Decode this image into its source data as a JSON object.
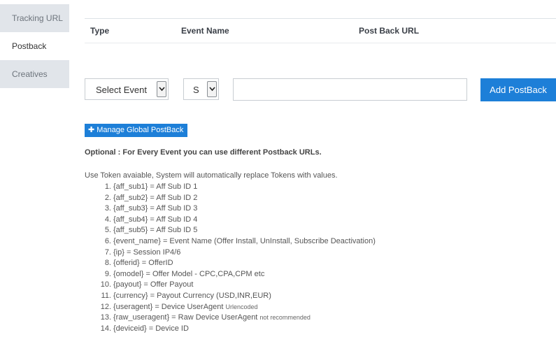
{
  "sidebar": {
    "items": [
      {
        "label": "Tracking URL"
      },
      {
        "label": "Postback"
      },
      {
        "label": "Creatives"
      }
    ]
  },
  "table": {
    "headers": [
      "Type",
      "Event Name",
      "Post Back URL"
    ]
  },
  "form": {
    "event_select": {
      "value": "Select Event"
    },
    "type_select": {
      "value": "S"
    },
    "url_input": {
      "value": "",
      "placeholder": ""
    },
    "add_label": "Add PostBack"
  },
  "global_button": {
    "label": "Manage Global PostBack"
  },
  "optional_text": "Optional : For Every Event you can use different Postback URLs.",
  "intro_text": "Use Token avaiable, System will automatically replace Tokens with values.",
  "tokens": [
    {
      "num": "1.",
      "text": "{aff_sub1} = Aff Sub ID 1",
      "note": ""
    },
    {
      "num": "2.",
      "text": "{aff_sub2} = Aff Sub ID 2",
      "note": ""
    },
    {
      "num": "3.",
      "text": "{aff_sub3} = Aff Sub ID 3",
      "note": ""
    },
    {
      "num": "4.",
      "text": "{aff_sub4} = Aff Sub ID 4",
      "note": ""
    },
    {
      "num": "5.",
      "text": "{aff_sub5} = Aff Sub ID 5",
      "note": ""
    },
    {
      "num": "6.",
      "text": "{event_name} = Event Name (Offer Install, UnInstall, Subscribe Deactivation)",
      "note": ""
    },
    {
      "num": "7.",
      "text": "{ip} = Session IP4/6",
      "note": ""
    },
    {
      "num": "8.",
      "text": "{offerid} = OfferID",
      "note": ""
    },
    {
      "num": "9.",
      "text": "{omodel} = Offer Model - CPC,CPA,CPM etc",
      "note": ""
    },
    {
      "num": "10.",
      "text": "{payout} = Offer Payout",
      "note": ""
    },
    {
      "num": "11.",
      "text": "{currency} = Payout Currency (USD,INR,EUR)",
      "note": ""
    },
    {
      "num": "12.",
      "text": "{useragent} = Device UserAgent",
      "note": "Urlencoded"
    },
    {
      "num": "13.",
      "text": "{raw_useragent} = Raw Device UserAgent",
      "note": "not recommended"
    },
    {
      "num": "14.",
      "text": "{deviceid} = Device ID",
      "note": ""
    }
  ],
  "colors": {
    "accent": "#1d7fd8",
    "sidebar_bg": "#e1e5ea"
  }
}
